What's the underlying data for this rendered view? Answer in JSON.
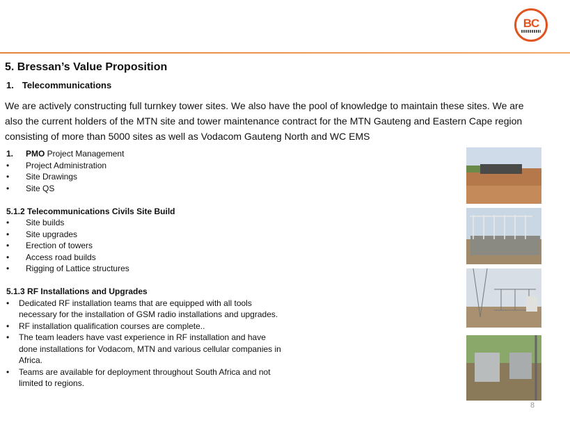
{
  "logo": {
    "text": "BC"
  },
  "title": "5. Bressan’s Value Proposition",
  "section": {
    "number": "1.",
    "title": "Telecommunications"
  },
  "intro": "We are actively constructing full turnkey tower sites. We also have the pool of knowledge to maintain these sites. We are also the current holders of the MTN site and tower maintenance contract for the MTN Gauteng and Eastern Cape region consisting of more than 5000 sites as well as Vodacom Gauteng North and WC EMS",
  "pmo": {
    "number": "1.",
    "bold": "PMO",
    "rest": " Project Management",
    "items": [
      "Project Administration",
      "Site Drawings",
      "Site QS"
    ]
  },
  "civils": {
    "heading": "5.1.2 Telecommunications Civils Site Build",
    "items": [
      "Site builds",
      "Site upgrades",
      "Erection of towers",
      "Access road builds",
      "Rigging of Lattice structures"
    ]
  },
  "rf": {
    "heading": "5.1.3 RF Installations and Upgrades",
    "items": [
      "Dedicated RF installation teams that are equipped with all tools necessary for the installation of GSM radio installations and upgrades.",
      "RF installation qualification courses are complete..",
      "The team leaders have vast experience in RF installation and have done installations for Vodacom, MTN and various cellular companies in Africa.",
      "Teams are available for deployment throughout South Africa and not limited to regions."
    ]
  },
  "bullet": "•",
  "page_number": "8"
}
